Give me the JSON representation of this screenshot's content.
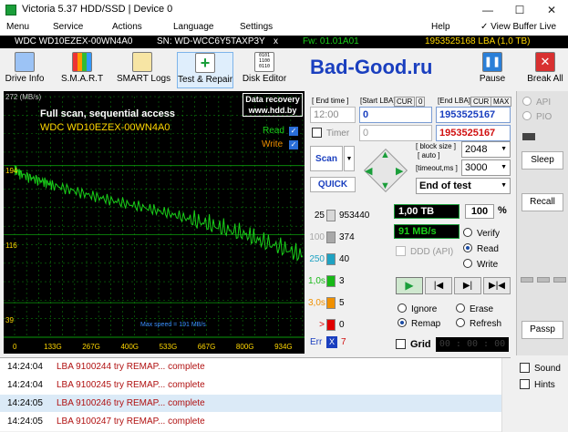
{
  "window": {
    "title": "Victoria 5.37 HDD/SSD | Device 0",
    "minimize": "—",
    "maximize": "☐",
    "close": "✕"
  },
  "menu": {
    "items": [
      "Menu",
      "Service",
      "Actions",
      "Language",
      "Settings",
      "Help"
    ],
    "view_buffer_live": "View Buffer Live"
  },
  "infobar": {
    "model": "WDC WD10EZEX-00WN4A0",
    "serial": "SN: WD-WCC6Y5TAXP3Y",
    "x": "x",
    "firmware": "Fw: 01.01A01",
    "lba": "1953525168 LBA (1,0 TB)"
  },
  "toolbar": {
    "items": [
      "Drive Info",
      "S.M.A.R.T",
      "SMART Logs",
      "Test & Repair",
      "Disk Editor"
    ],
    "brand": "Bad-Good.ru",
    "pause": "Pause",
    "break_all": "Break All"
  },
  "graph": {
    "y_top_label": "272 (MB/s)",
    "y_ticks": [
      "194",
      "116",
      "39"
    ],
    "x_ticks": [
      "0",
      "133G",
      "267G",
      "400G",
      "533G",
      "667G",
      "800G",
      "934G"
    ],
    "line1": "Full scan, sequential access",
    "line2": "WDC WD10EZEX-00WN4A0",
    "recovery_line1": "Data recovery",
    "recovery_line2": "www.hdd.by",
    "read_label": "Read",
    "write_label": "Write",
    "max_speed": "Max speed = 191 MB/s",
    "colors": {
      "read": "#19d019",
      "grid": "#0c7a0c",
      "accent": "#ffd700"
    }
  },
  "chart_data": {
    "type": "line",
    "xlabel": "",
    "ylabel": "(MB/s)",
    "ylim": [
      0,
      272
    ],
    "x_ticks": [
      "0",
      "133G",
      "267G",
      "400G",
      "533G",
      "667G",
      "800G",
      "934G"
    ],
    "series": [
      {
        "name": "Read",
        "x_gb": [
          0,
          20,
          60,
          100,
          133,
          200,
          267,
          330,
          400,
          470,
          533,
          600,
          667,
          730,
          800,
          860,
          934,
          1000
        ],
        "values": [
          191,
          185,
          180,
          176,
          172,
          166,
          160,
          155,
          150,
          145,
          140,
          134,
          128,
          122,
          116,
          108,
          100,
          92
        ]
      }
    ]
  },
  "panel": {
    "end_time_label": "[ End time ]",
    "start_lba_label": "[Start LBA]",
    "cur_label": "CUR",
    "zero_label": "0",
    "end_lba_label": "[End LBA]",
    "max_label": "MAX",
    "end_time_value": "12:00",
    "start_lba_value": "0",
    "end_lba_value": "1953525167",
    "timer_label": "Timer",
    "timer_value": "0",
    "end_lba_value2": "1953525167",
    "block_size_label": "[ block size ]",
    "auto_label": "[ auto ]",
    "timeout_label": "[timeout,ms ]",
    "block_size_value": "2048",
    "timeout_value": "3000",
    "end_action": "End of test",
    "scan": "Scan",
    "quick": "QUICK"
  },
  "stats": {
    "rows": [
      {
        "label": "25",
        "count": "953440",
        "color": "#d8d8d8"
      },
      {
        "label": "100",
        "count": "374",
        "color": "#a8a8a8"
      },
      {
        "label": "250",
        "count": "40",
        "color": "#1fa2c2"
      },
      {
        "label": "1,0s",
        "count": "3",
        "color": "#17b817"
      },
      {
        "label": "3,0s",
        "count": "5",
        "color": "#f09000"
      },
      {
        "label": ">",
        "count": "0",
        "color": "#e00000"
      }
    ],
    "err_label": "Err",
    "err_count": "7"
  },
  "progress": {
    "tb": "1,00 TB",
    "percent": "100",
    "percent_sign": "%",
    "speed": "91 MB/s",
    "ddd": "DDD (API)",
    "verify": "Verify",
    "read": "Read",
    "write": "Write"
  },
  "actions": {
    "ignore": "Ignore",
    "erase": "Erase",
    "remap": "Remap",
    "refresh": "Refresh",
    "grid": "Grid",
    "grid_time": "00 : 00 : 00"
  },
  "right": {
    "api": "API",
    "pio": "PIO",
    "sleep": "Sleep",
    "recall": "Recall",
    "passp": "Passp"
  },
  "bottom_right": {
    "sound": "Sound",
    "hints": "Hints"
  },
  "log": [
    {
      "time": "14:24:04",
      "msg": "LBA 9100244 try REMAP... complete"
    },
    {
      "time": "14:24:04",
      "msg": "LBA 9100245 try REMAP... complete"
    },
    {
      "time": "14:24:05",
      "msg": "LBA 9100246 try REMAP... complete"
    },
    {
      "time": "14:24:05",
      "msg": "LBA 9100247 try REMAP... complete"
    }
  ]
}
